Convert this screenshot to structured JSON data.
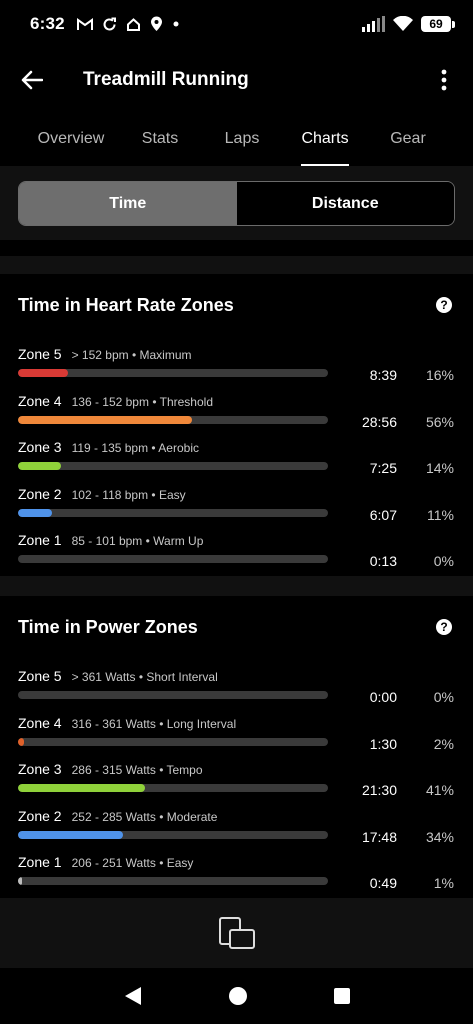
{
  "status_bar": {
    "time": "6:32",
    "battery": "69",
    "icons_left": [
      "gmail-icon",
      "sync-icon",
      "home-icon",
      "location-icon",
      "dot-icon"
    ],
    "icons_right": [
      "signal-icon",
      "wifi-icon",
      "battery-icon"
    ]
  },
  "app_bar": {
    "title": "Treadmill Running"
  },
  "tabs": [
    {
      "label": "Overview",
      "active": false
    },
    {
      "label": "Stats",
      "active": false
    },
    {
      "label": "Laps",
      "active": false
    },
    {
      "label": "Charts",
      "active": true
    },
    {
      "label": "Gear",
      "active": false
    }
  ],
  "segmented": {
    "time_label": "Time",
    "distance_label": "Distance",
    "selected": "Time"
  },
  "heart_rate_zones": {
    "title": "Time in Heart Rate Zones",
    "zones": [
      {
        "name": "Zone 5",
        "desc": "> 152 bpm • Maximum",
        "time": "8:39",
        "percent": "16%",
        "fill": 0.16,
        "color": "#d93a35"
      },
      {
        "name": "Zone 4",
        "desc": "136 - 152 bpm • Threshold",
        "time": "28:56",
        "percent": "56%",
        "fill": 0.56,
        "color": "#f0883a"
      },
      {
        "name": "Zone 3",
        "desc": "119 - 135 bpm • Aerobic",
        "time": "7:25",
        "percent": "14%",
        "fill": 0.14,
        "color": "#8fd13a"
      },
      {
        "name": "Zone 2",
        "desc": "102 - 118 bpm • Easy",
        "time": "6:07",
        "percent": "11%",
        "fill": 0.11,
        "color": "#4f93ea"
      },
      {
        "name": "Zone 1",
        "desc": "85 - 101 bpm • Warm Up",
        "time": "0:13",
        "percent": "0%",
        "fill": 0.0,
        "color": "#a0a0a0"
      }
    ]
  },
  "power_zones": {
    "title": "Time in Power Zones",
    "zones": [
      {
        "name": "Zone 5",
        "desc": "> 361 Watts • Short Interval",
        "time": "0:00",
        "percent": "0%",
        "fill": 0.0,
        "color": "#d93a35"
      },
      {
        "name": "Zone 4",
        "desc": "316 - 361 Watts • Long Interval",
        "time": "1:30",
        "percent": "2%",
        "fill": 0.02,
        "color": "#e0612a"
      },
      {
        "name": "Zone 3",
        "desc": "286 - 315 Watts • Tempo",
        "time": "21:30",
        "percent": "41%",
        "fill": 0.41,
        "color": "#8fd13a"
      },
      {
        "name": "Zone 2",
        "desc": "252 - 285 Watts • Moderate",
        "time": "17:48",
        "percent": "34%",
        "fill": 0.34,
        "color": "#4f93ea"
      },
      {
        "name": "Zone 1",
        "desc": "206 - 251 Watts • Easy",
        "time": "0:49",
        "percent": "1%",
        "fill": 0.01,
        "color": "#bdbdbd"
      }
    ]
  },
  "action_bar": {
    "icon": "rotate-screen-icon"
  },
  "nav_bar": {
    "icons": [
      "back-nav-icon",
      "home-nav-icon",
      "recents-nav-icon"
    ]
  }
}
